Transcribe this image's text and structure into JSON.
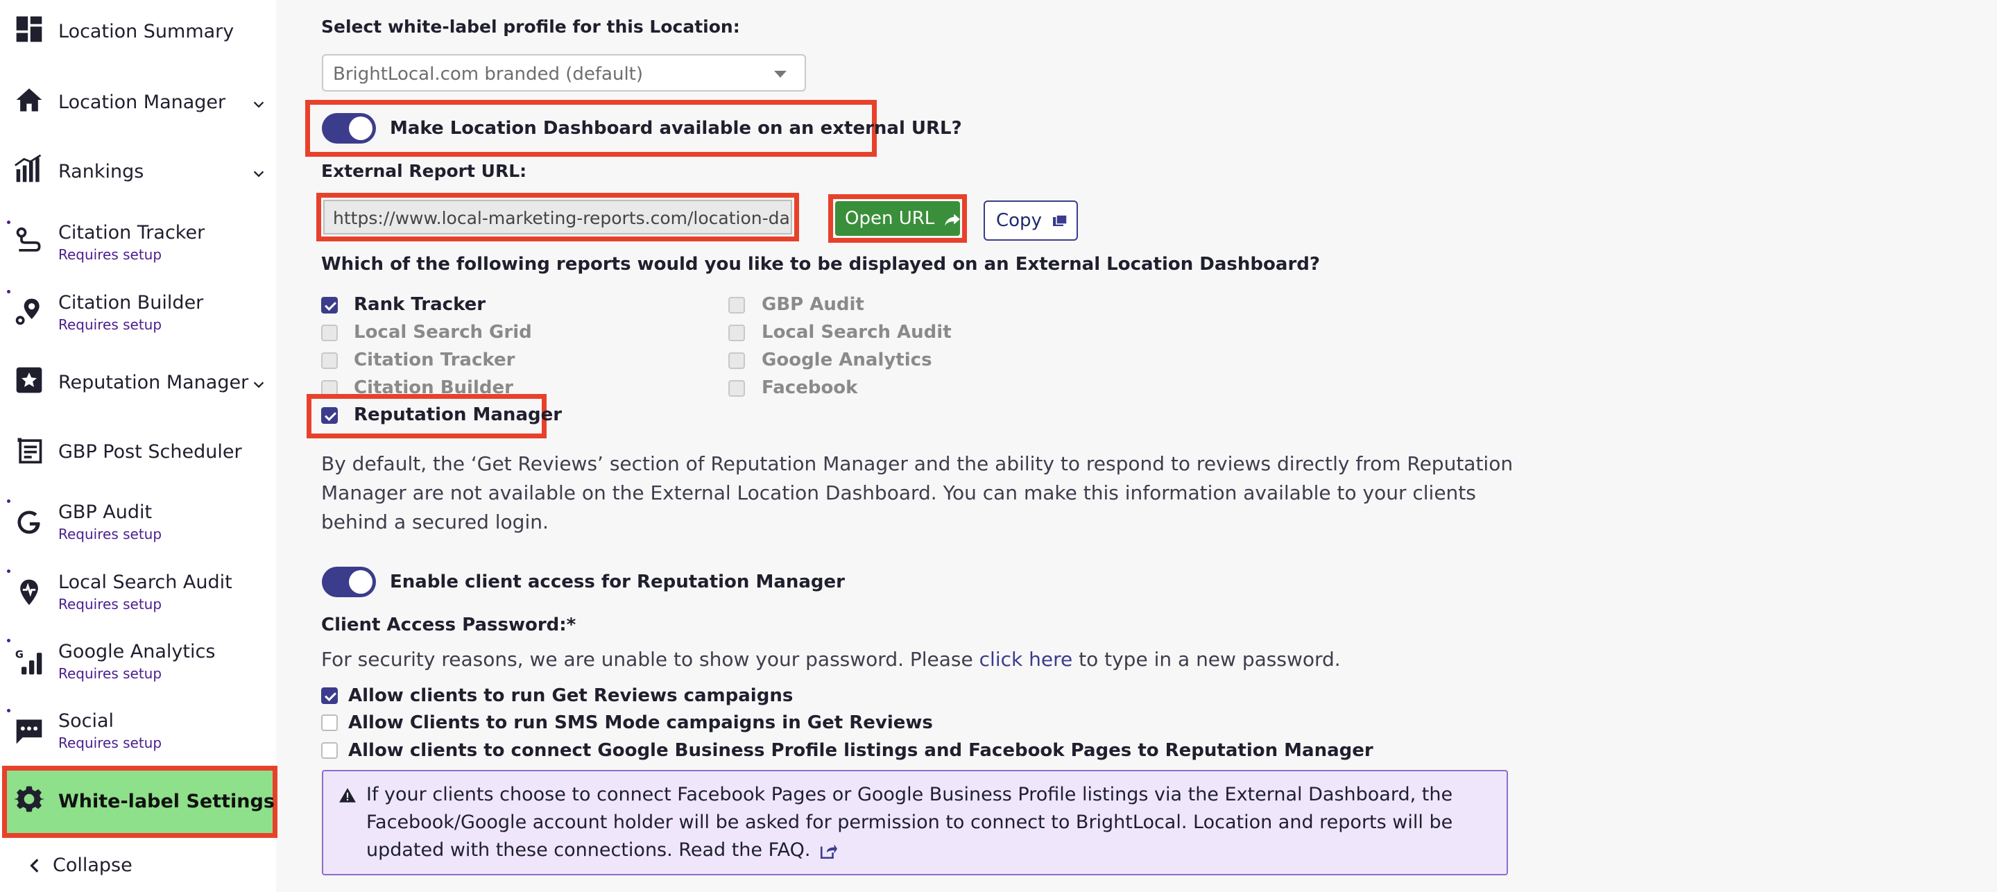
{
  "sidebar": {
    "items": [
      {
        "label": "Location Summary",
        "sub": "",
        "icon": "dashboard-grid-icon"
      },
      {
        "label": "Location Manager",
        "sub": "",
        "icon": "home-icon"
      },
      {
        "label": "Rankings",
        "sub": "",
        "icon": "rankings-bars-icon"
      },
      {
        "label": "Citation Tracker",
        "sub": "Requires setup",
        "icon": "route-icon"
      },
      {
        "label": "Citation Builder",
        "sub": "Requires setup",
        "icon": "map-pin-icon"
      },
      {
        "label": "Reputation Manager",
        "sub": "",
        "icon": "star-badge-icon"
      },
      {
        "label": "GBP Post Scheduler",
        "sub": "",
        "icon": "post-list-icon"
      },
      {
        "label": "GBP Audit",
        "sub": "Requires setup",
        "icon": "google-g-icon"
      },
      {
        "label": "Local Search Audit",
        "sub": "Requires setup",
        "icon": "pin-pulse-icon"
      },
      {
        "label": "Google Analytics",
        "sub": "Requires setup",
        "icon": "analytics-bars-icon"
      },
      {
        "label": "Social",
        "sub": "Requires setup",
        "icon": "chat-bubble-icon"
      },
      {
        "label": "White-label Settings",
        "sub": "",
        "icon": "gear-icon"
      }
    ],
    "collapse_label": "Collapse"
  },
  "main": {
    "profile_label": "Select white-label profile for this Location:",
    "profile_value": "BrightLocal.com branded (default)",
    "external_toggle_label": "Make Location Dashboard available on an external URL?",
    "external_url_label": "External Report URL:",
    "external_url_value": "https://www.local-marketing-reports.com/location-dashb",
    "open_url_label": "Open URL",
    "copy_label": "Copy",
    "reports_question": "Which of the following reports would you like to be displayed on an External Location Dashboard?",
    "reports_left": [
      {
        "label": "Rank Tracker",
        "checked": true
      },
      {
        "label": "Local Search Grid",
        "checked": false
      },
      {
        "label": "Citation Tracker",
        "checked": false
      },
      {
        "label": "Citation Builder",
        "checked": false
      },
      {
        "label": "Reputation Manager",
        "checked": true
      }
    ],
    "reports_right": [
      {
        "label": "GBP Audit",
        "checked": false
      },
      {
        "label": "Local Search Audit",
        "checked": false
      },
      {
        "label": "Google Analytics",
        "checked": false
      },
      {
        "label": "Facebook",
        "checked": false
      }
    ],
    "default_note": "By default, the ‘Get Reviews’ section of Reputation Manager and the ability to respond to reviews directly from Reputation Manager are not available on the External Location Dashboard. You can make this information available to your clients behind a secured login.",
    "client_access_label": "Enable client access for Reputation Manager",
    "password_label": "Client Access Password:*",
    "password_note_before": "For security reasons, we are unable to show your password. Please ",
    "password_note_link": "click here",
    "password_note_after": " to type in a new password.",
    "client_options": [
      {
        "label": "Allow clients to run Get Reviews campaigns",
        "checked": true
      },
      {
        "label": "Allow Clients to run SMS Mode campaigns in Get Reviews",
        "checked": false
      },
      {
        "label": "Allow clients to connect Google Business Profile listings and Facebook Pages to Reputation Manager",
        "checked": false
      }
    ],
    "notice_text": "If your clients choose to connect Facebook Pages or Google Business Profile listings via the External Dashboard, the Facebook/Google account holder will be asked for permission to connect to BrightLocal. Location and reports will be updated with these connections. Read the FAQ."
  },
  "colors": {
    "accent": "#3b3c8c",
    "highlight_red": "#e8412b",
    "active_green": "#8ee08a",
    "open_button_green": "#3a8f3a",
    "requires_setup_purple": "#4b1d8f"
  }
}
